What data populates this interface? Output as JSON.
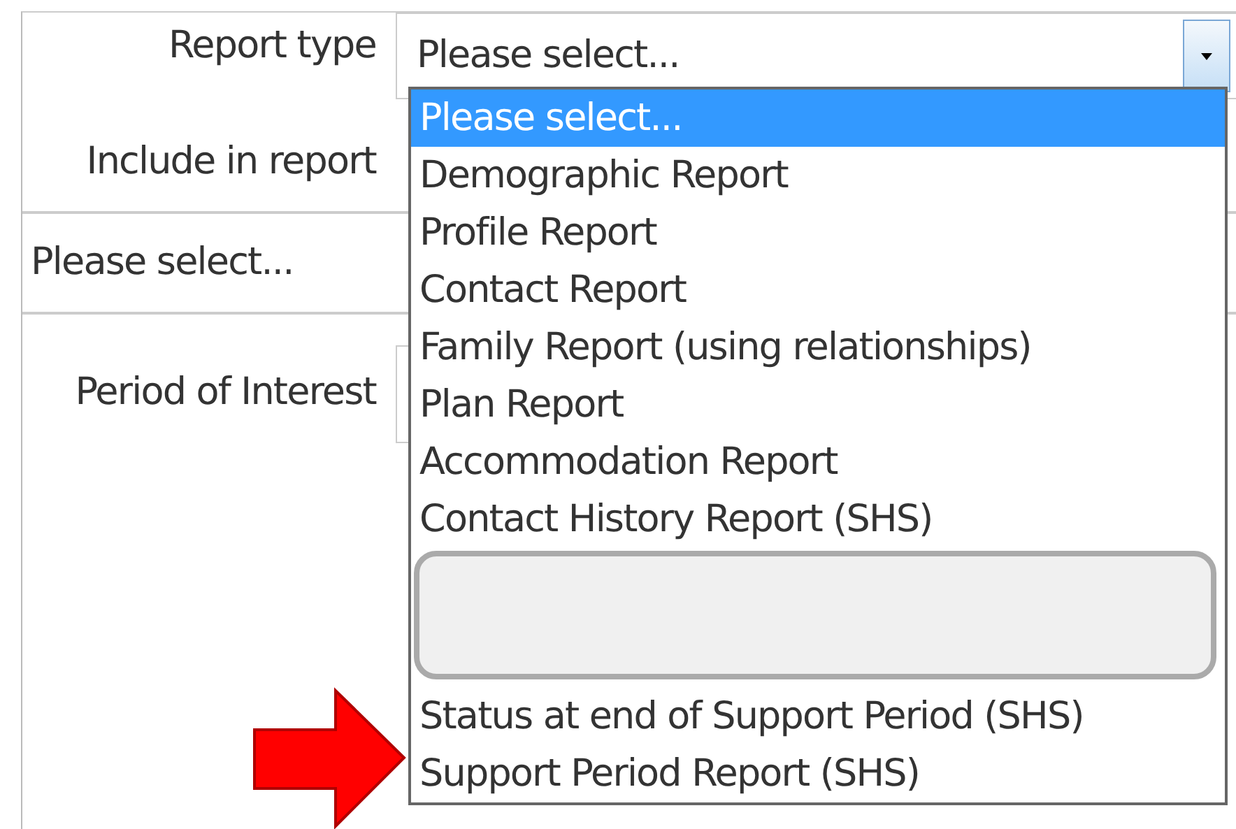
{
  "form": {
    "report_type": {
      "label": "Report type",
      "value": "Please select...",
      "expanded": true,
      "options": [
        {
          "kind": "option",
          "label": "Please select...",
          "selected": true
        },
        {
          "kind": "option",
          "label": "Demographic Report",
          "selected": false
        },
        {
          "kind": "option",
          "label": "Profile Report",
          "selected": false
        },
        {
          "kind": "option",
          "label": "Contact Report",
          "selected": false
        },
        {
          "kind": "option",
          "label": "Family Report (using relationships)",
          "selected": false
        },
        {
          "kind": "option",
          "label": "Plan Report",
          "selected": false
        },
        {
          "kind": "option",
          "label": "Accommodation Report",
          "selected": false
        },
        {
          "kind": "option",
          "label": "Contact History Report (SHS)",
          "selected": false
        },
        {
          "kind": "redacted"
        },
        {
          "kind": "option",
          "label": "Status at end of Support Period (SHS)",
          "selected": false
        },
        {
          "kind": "option",
          "label": "Support Period Report (SHS)",
          "selected": false
        }
      ]
    },
    "include_in_report": {
      "label": "Include in report"
    },
    "secondary_select": {
      "value": "Please select..."
    },
    "period_of_interest": {
      "label": "Period of Interest"
    }
  },
  "annotation": {
    "kind": "arrow"
  }
}
